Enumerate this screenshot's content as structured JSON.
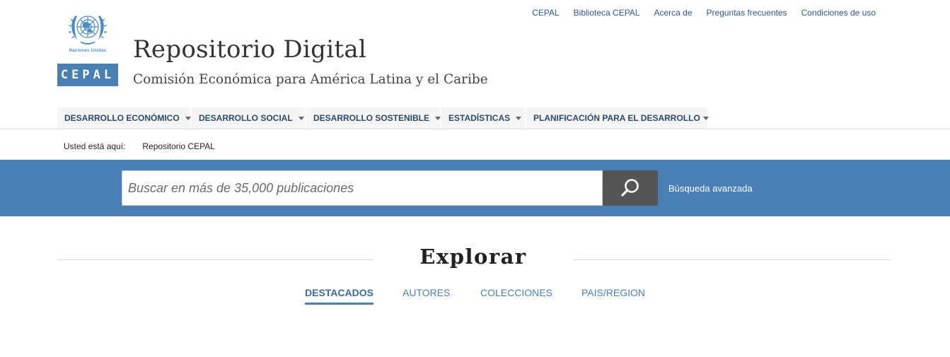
{
  "top_links": [
    "CEPAL",
    "Biblioteca CEPAL",
    "Acerca de",
    "Preguntas frecuentes",
    "Condiciones de uso"
  ],
  "logo": {
    "un_text": "Naciones Unidas",
    "cepal_text": "CEPAL"
  },
  "header": {
    "title": "Repositorio Digital",
    "subtitle": "Comisión Económica para América Latina y el Caribe"
  },
  "nav": [
    {
      "label": "DESARROLLO ECONÓMICO"
    },
    {
      "label": "DESARROLLO SOCIAL"
    },
    {
      "label": "DESARROLLO SOSTENIBLE"
    },
    {
      "label": "ESTADÍSTICAS"
    },
    {
      "label": "PLANIFICACIÓN PARA EL DESARROLLO"
    }
  ],
  "breadcrumb": {
    "label": "Usted está aquí:",
    "current": "Repositorio CEPAL"
  },
  "search": {
    "placeholder": "Buscar en más de 35,000 publicaciones",
    "value": "",
    "advanced_label": "Búsqueda avanzada"
  },
  "explore": {
    "title": "Explorar",
    "tabs": [
      {
        "label": "DESTACADOS",
        "active": true
      },
      {
        "label": "AUTORES",
        "active": false
      },
      {
        "label": "COLECCIONES",
        "active": false
      },
      {
        "label": "PAIS/REGION",
        "active": false
      }
    ]
  },
  "colors": {
    "brand_blue": "#4a7fb5",
    "search_button": "#555555",
    "nav_text": "#2b4a66"
  },
  "icons": {
    "search": "search-icon",
    "un_emblem": "un-emblem-icon",
    "dropdown": "caret-down-icon"
  }
}
